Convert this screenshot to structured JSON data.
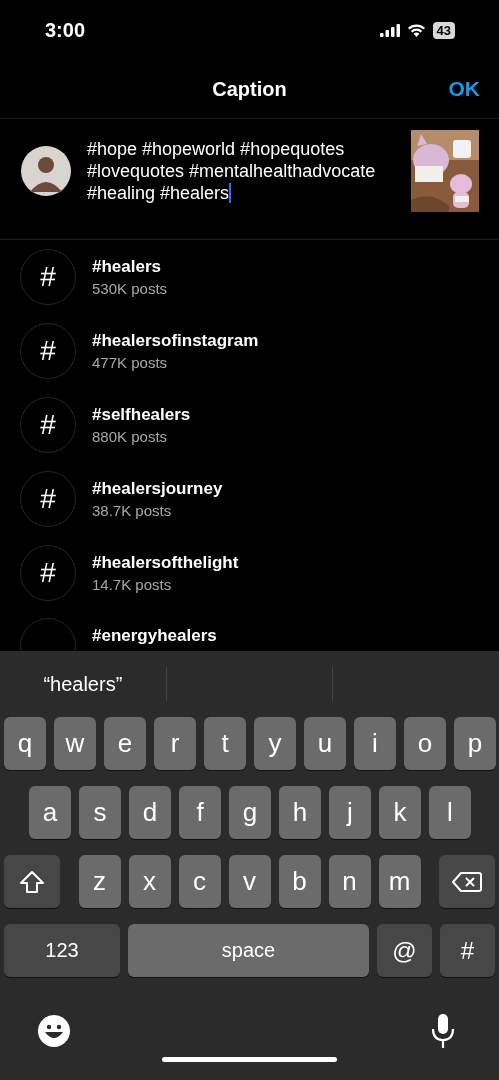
{
  "status_bar": {
    "time": "3:00",
    "battery": "43"
  },
  "header": {
    "title": "Caption",
    "action": "OK"
  },
  "caption": {
    "value": "#hope #hopeworld #hopequotes #lovequotes #mentalhealthadvocate #healing #healers"
  },
  "suggestions": [
    {
      "icon": "#",
      "tag": "#healers",
      "count": "530K posts"
    },
    {
      "icon": "#",
      "tag": "#healersofinstagram",
      "count": "477K posts"
    },
    {
      "icon": "#",
      "tag": "#selfhealers",
      "count": "880K posts"
    },
    {
      "icon": "#",
      "tag": "#healersjourney",
      "count": "38.7K posts"
    },
    {
      "icon": "#",
      "tag": "#healersofthelight",
      "count": "14.7K posts"
    },
    {
      "tag": "#energyhealers"
    }
  ],
  "keyboard": {
    "prediction": "“healers”",
    "rows": [
      [
        "q",
        "w",
        "e",
        "r",
        "t",
        "y",
        "u",
        "i",
        "o",
        "p"
      ],
      [
        "a",
        "s",
        "d",
        "f",
        "g",
        "h",
        "j",
        "k",
        "l"
      ],
      [
        "z",
        "x",
        "c",
        "v",
        "b",
        "n",
        "m"
      ]
    ],
    "bottom": [
      {
        "kind": "mode",
        "label": "123"
      },
      {
        "kind": "space",
        "label": "space"
      },
      {
        "kind": "symbol",
        "label": "@"
      },
      {
        "kind": "symbol",
        "label": "#"
      }
    ]
  }
}
